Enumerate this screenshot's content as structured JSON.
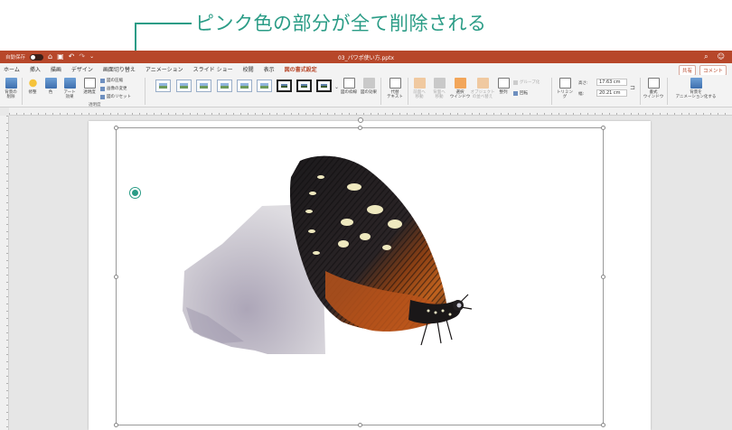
{
  "annotation": {
    "text": "ピンク色の部分が全て削除される",
    "color": "#2a9c86"
  },
  "titlebar": {
    "autosave_label": "自動保存",
    "autosave_state": "オフ",
    "file_name": "03_パワポ使い方.pptx",
    "icons": [
      "home-icon",
      "save-icon",
      "undo-icon",
      "redo-icon",
      "search-icon",
      "smiley-icon"
    ],
    "color": "#b7472a"
  },
  "tabs": [
    {
      "label": "ホーム",
      "active": false
    },
    {
      "label": "挿入",
      "active": false
    },
    {
      "label": "描画",
      "active": false
    },
    {
      "label": "デザイン",
      "active": false
    },
    {
      "label": "画面切り替え",
      "active": false
    },
    {
      "label": "アニメーション",
      "active": false
    },
    {
      "label": "スライド ショー",
      "active": false
    },
    {
      "label": "校閲",
      "active": false
    },
    {
      "label": "表示",
      "active": false
    },
    {
      "label": "図の書式設定",
      "active": true
    }
  ],
  "share": {
    "share_label": "共有",
    "comment_label": "コメント"
  },
  "ribbon": {
    "remove_bg": "背景の\n削除",
    "corrections": "修整",
    "color": "色",
    "artistic": "アート\n効果",
    "transparency": "透明度",
    "transparency_tooltip": "透明度",
    "compress": "図の圧縮",
    "change_picture": "画像の変更",
    "reset_picture": "図のリセット",
    "border": "図の枠線",
    "effects": "図の効果",
    "alt_text": "代替\nテキスト",
    "bring_forward": "前面へ\n移動",
    "send_backward": "背面へ\n移動",
    "selection_pane": "選択\nウインドウ",
    "arrange_objects": "オブジェクト\nの並べ替え",
    "align": "整列",
    "group": "グループ化",
    "rotate": "回転",
    "crop": "トリミング",
    "height_label": "高さ:",
    "height_value": "17.63 cm",
    "width_label": "幅:",
    "width_value": "20.21 cm",
    "format_pane": "書式\nウインドウ",
    "animate_bg": "背景を\nアニメーション化する"
  }
}
